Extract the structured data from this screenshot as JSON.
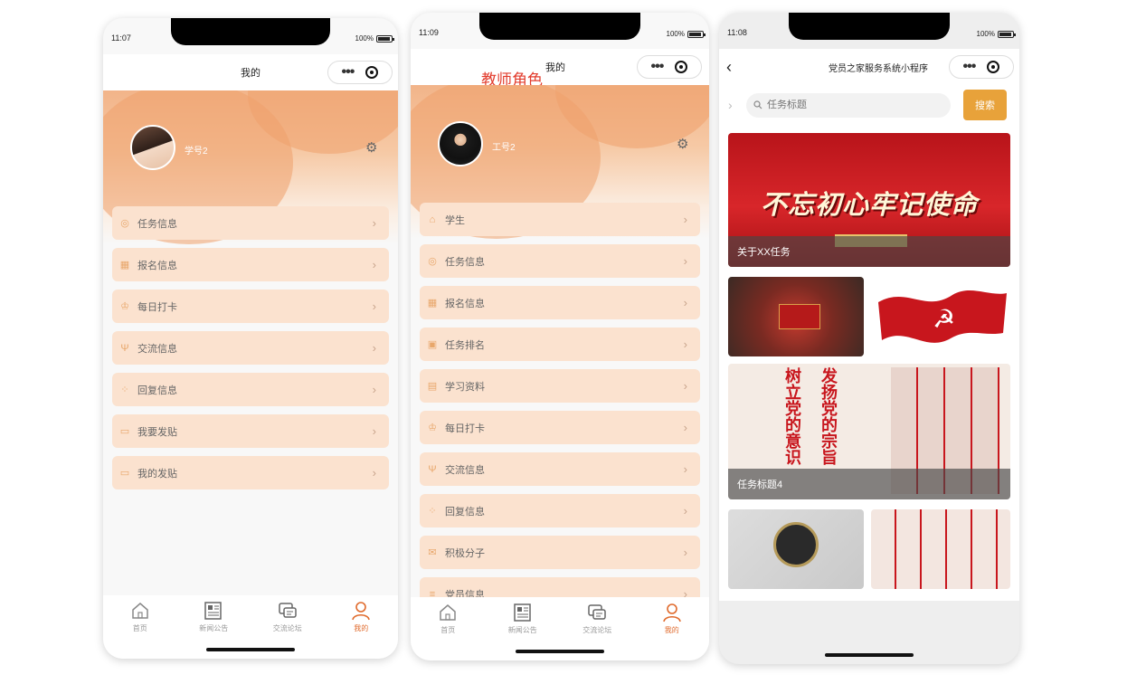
{
  "phone1": {
    "time": "11:07",
    "battery": "100%",
    "title": "我的",
    "username": "学号2",
    "menu": [
      "任务信息",
      "报名信息",
      "每日打卡",
      "交流信息",
      "回复信息",
      "我要发贴",
      "我的发贴"
    ],
    "tabs": [
      "首页",
      "新闻公告",
      "交流论坛",
      "我的"
    ]
  },
  "phone2": {
    "time": "11:09",
    "battery": "100%",
    "title": "我的",
    "role_tag": "教师角色",
    "username": "工号2",
    "menu": [
      "学生",
      "任务信息",
      "报名信息",
      "任务排名",
      "学习资料",
      "每日打卡",
      "交流信息",
      "回复信息",
      "积极分子",
      "党员信息"
    ],
    "tabs": [
      "首页",
      "新闻公告",
      "交流论坛",
      "我的"
    ]
  },
  "phone3": {
    "time": "11:08",
    "battery": "100%",
    "title": "党员之家服务系统小程序",
    "search_placeholder": "任务标题",
    "search_button": "搜索",
    "banner_text": "不忘初心牢记使命",
    "captions": [
      "关于XX任务",
      "任务标题4"
    ],
    "poster_text": [
      "树立党的意识",
      "发扬党的宗旨"
    ]
  },
  "colors": {
    "accent": "#e06a2c",
    "menu_bg": "#fbe2cf",
    "search_btn": "#e8a23a",
    "party_red": "#c8161d"
  },
  "icons": [
    "settings-icon",
    "back-icon",
    "more-icon",
    "target-icon",
    "search-icon",
    "home-icon",
    "news-icon",
    "forum-icon",
    "user-icon"
  ]
}
